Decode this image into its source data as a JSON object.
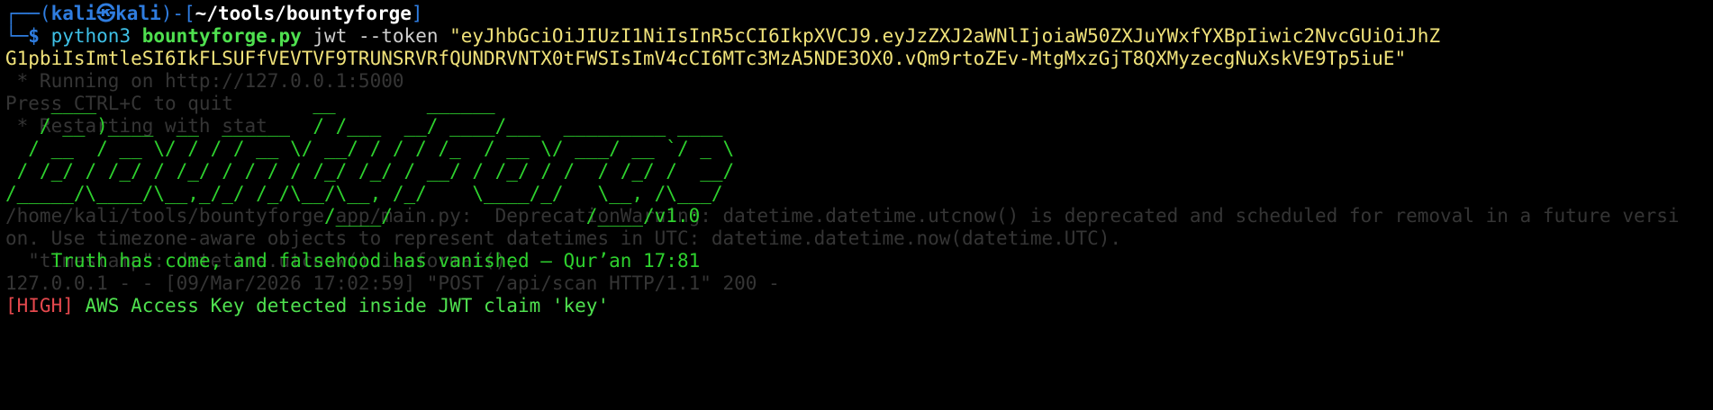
{
  "prompt": {
    "frame_top": "┌──(",
    "user": "kali",
    "skull": "㉿",
    "host": "kali",
    "frame_mid": ")-[",
    "directory": "~/tools/bountyforge",
    "frame_end": "]",
    "frame_bottom": "└─",
    "dollar": "$ "
  },
  "command": {
    "binary": "python3 ",
    "script": "bountyforge.py",
    "subcommand": " jwt --token ",
    "token_line1": "\"eyJhbGciOiJIUzI1NiIsInR5cCI6IkpXVCJ9.eyJzZXJ2aWNlIjoiaW50ZXJuYWxfYXBpIiwic2NvcGUiOiJhZ",
    "token_line2": "G1pbiIsImtleSI6IkFLSUFfVEVTVF9TRUNSRVRfQUNDRVNTX0tFWSIsImV4cCI6MTc3MzA5NDE3OX0.vQm9rtoZEv-MtgMxzGjT8QXMyzecgNuXskVE9Tp5iuE\""
  },
  "ghost_lines": [
    " * Running on http://127.0.0.1:5000",
    "Press CTRL+C to quit",
    " * Restarting with stat",
    "",
    "",
    "",
    "/home/kali/tools/bountyforge/app/main.py:  DeprecationWarning: datetime.datetime.utcnow() is deprecated and scheduled for removal in a future versi",
    "on. Use timezone-aware objects to represent datetimes in UTC: datetime.datetime.now(datetime.UTC).",
    "  \"timestamp\": datetime.utcnow().isoformat(),",
    "127.0.0.1 - - [09/Mar/2026 17:02:59] \"POST /api/scan HTTP/1.1\" 200 -"
  ],
  "banner_lines": [
    "    ____                   __        ______",
    "   / __ )____  __  ______  / /___  __/ ____/___  _________ ____",
    "  / __  / __ \\/ / / / __ \\/ __/ / / / /_  / __ \\/ ___/ __ `/ _ \\",
    " / /_/ / /_/ / /_/ / / / / /_/ /_/ / __/ / /_/ / /  / /_/ /  __/",
    "/_____/\\____/\\__,_/_/ /_/\\__/\\__, /_/    \\____/_/   \\__, /\\___/",
    "                            /____/                 /____/"
  ],
  "version": "v1.0",
  "quote": "Truth has come, and falsehood has vanished — Qur’an 17:81",
  "alert": {
    "severity": "[HIGH]",
    "message": " AWS Access Key detected inside JWT claim 'key'"
  },
  "colors": {
    "background": "#000000",
    "prompt_blue": "#2f7de0",
    "banner_green": "#2ed12e",
    "severity_red": "#e5484d",
    "token_yellow": "#f0e27a"
  }
}
